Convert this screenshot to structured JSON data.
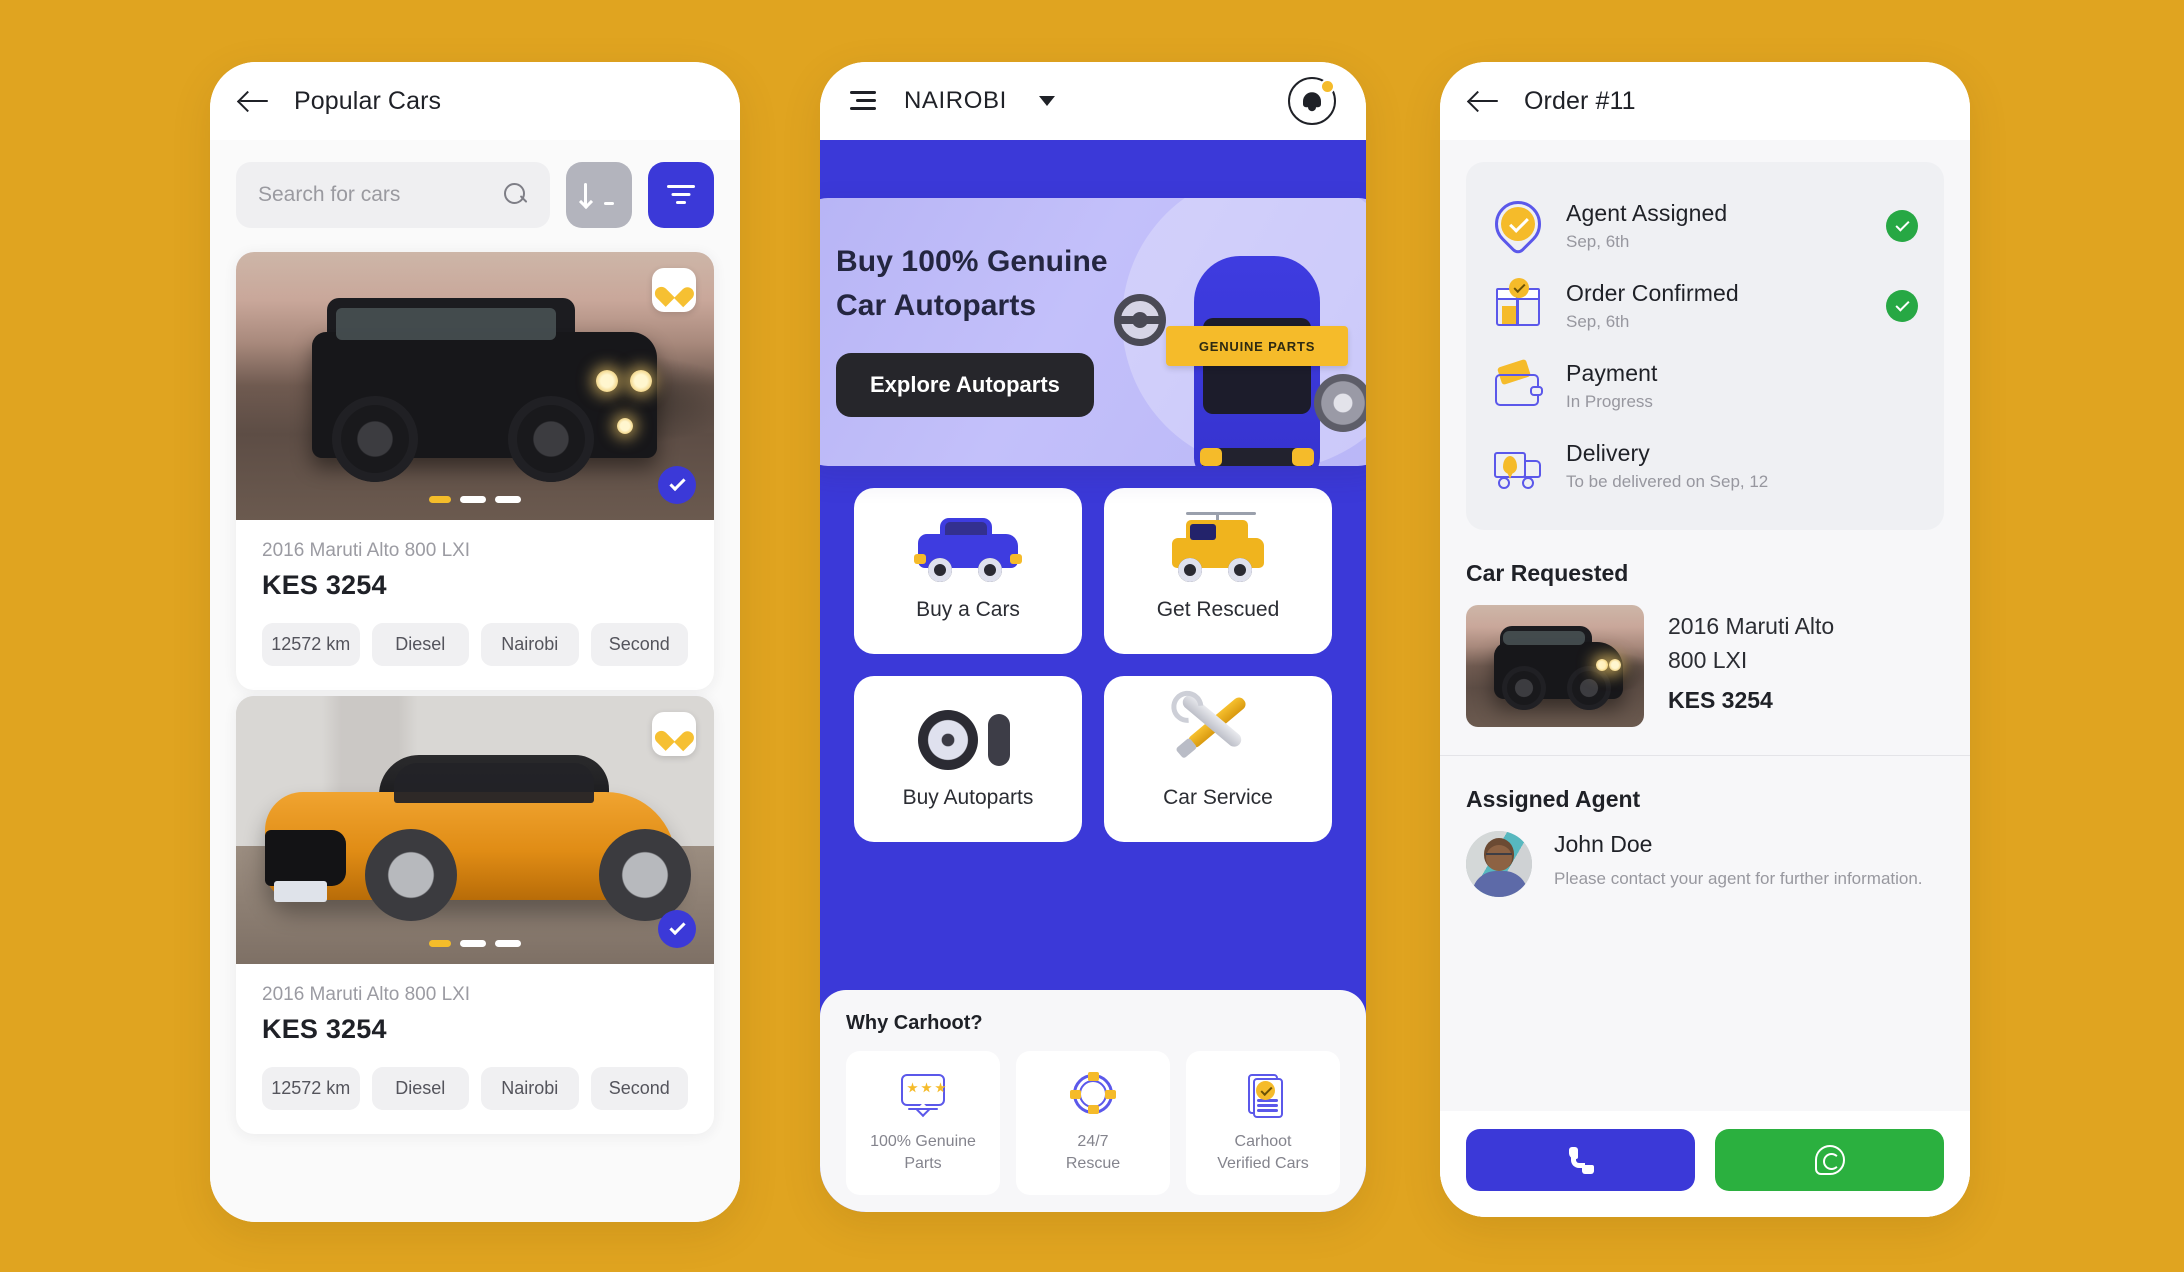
{
  "background_color": "#e0a420",
  "brand": {
    "primary": "#3b39d8",
    "accent": "#f5bb2a",
    "success": "#27a844",
    "whatsapp": "#2bb03f"
  },
  "left_phone": {
    "header": {
      "title": "Popular Cars",
      "back_icon": "back-arrow-icon"
    },
    "search": {
      "placeholder": "Search for cars",
      "search_icon": "search-icon"
    },
    "sort_button": {
      "icon": "sort-descending-icon"
    },
    "filter_button": {
      "icon": "filter-icon"
    },
    "cars": [
      {
        "name": "2016 Maruti Alto 800 LXI",
        "price": "KES 3254",
        "tags": [
          "12572 km",
          "Diesel",
          "Nairobi",
          "Second"
        ],
        "favorite_icon": "heart-icon",
        "verified_icon": "check-circle-icon",
        "carousel_dots": 3,
        "carousel_active": 0
      },
      {
        "name": "2016 Maruti Alto 800 LXI",
        "price": "KES 3254",
        "tags": [
          "12572 km",
          "Diesel",
          "Nairobi",
          "Second"
        ],
        "favorite_icon": "heart-icon",
        "verified_icon": "check-circle-icon",
        "carousel_dots": 3,
        "carousel_active": 0
      }
    ]
  },
  "center_phone": {
    "header": {
      "menu_icon": "hamburger-menu-icon",
      "city": "NAIROBI",
      "caret_icon": "chevron-down-icon",
      "bell_icon": "notification-bell-icon"
    },
    "banner": {
      "line1": "Buy 100% Genuine",
      "line2": "Car Autoparts",
      "cta": "Explore Autoparts",
      "ribbon": "GENUINE PARTS",
      "steering_icon": "steering-wheel-icon",
      "car_icon": "blue-car-top-icon",
      "wheel_icon": "wheel-icon"
    },
    "tiles": [
      {
        "label": "Buy a Cars",
        "icon": "car-icon"
      },
      {
        "label": "Get Rescued",
        "icon": "tow-truck-icon"
      },
      {
        "label": "Buy Autoparts",
        "icon": "tyre-rim-icon"
      },
      {
        "label": "Car Service",
        "icon": "wrench-screwdriver-icon"
      }
    ],
    "why": {
      "title": "Why Carhoot?",
      "items": [
        {
          "line1": "100% Genuine",
          "line2": "Parts",
          "icon": "review-stars-icon"
        },
        {
          "line1": "24/7",
          "line2": "Rescue",
          "icon": "lifebuoy-icon"
        },
        {
          "line1": "Carhoot",
          "line2": "Verified Cars",
          "icon": "verified-document-icon"
        }
      ]
    }
  },
  "right_phone": {
    "header": {
      "title": "Order #11",
      "back_icon": "back-arrow-icon"
    },
    "timeline": [
      {
        "title": "Agent Assigned",
        "sub": "Sep, 6th",
        "icon": "agent-pin-icon",
        "done": true
      },
      {
        "title": "Order Confirmed",
        "sub": "Sep, 6th",
        "icon": "package-box-icon",
        "done": true
      },
      {
        "title": "Payment",
        "sub": "In Progress",
        "icon": "wallet-icon",
        "done": false
      },
      {
        "title": "Delivery",
        "sub": "To be delivered on Sep, 12",
        "icon": "delivery-truck-icon",
        "done": false
      }
    ],
    "car_requested": {
      "section_title": "Car Requested",
      "name_line1": "2016 Maruti Alto",
      "name_line2": "800 LXI",
      "price": "KES 3254"
    },
    "assigned_agent": {
      "section_title": "Assigned Agent",
      "name": "John Doe",
      "note": "Please contact your agent for further information."
    },
    "actions": [
      {
        "name": "call",
        "icon": "phone-icon"
      },
      {
        "name": "whatsapp",
        "icon": "whatsapp-icon"
      }
    ]
  }
}
